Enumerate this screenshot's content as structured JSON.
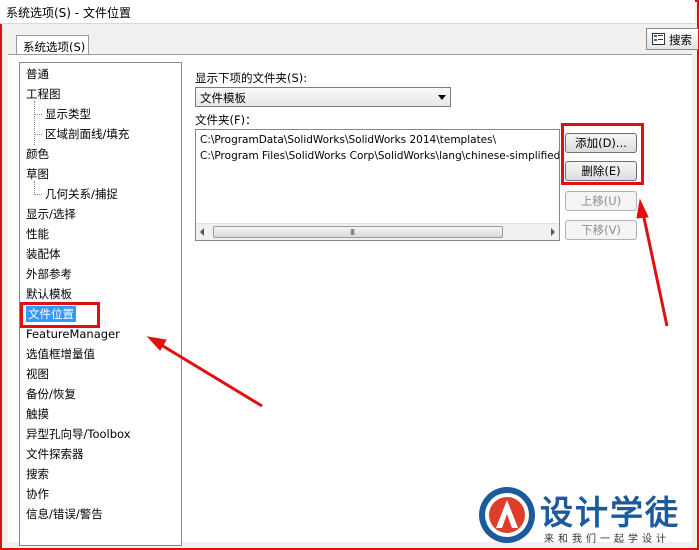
{
  "window": {
    "title": "系统选项(S) - 文件位置"
  },
  "tabs": [
    {
      "label": "系统选项(S)"
    }
  ],
  "search": {
    "label": "搜索"
  },
  "tree": {
    "items": [
      {
        "label": "普通",
        "level": 0
      },
      {
        "label": "工程图",
        "level": 0
      },
      {
        "label": "显示类型",
        "level": 1
      },
      {
        "label": "区域剖面线/填充",
        "level": 1
      },
      {
        "label": "颜色",
        "level": 0
      },
      {
        "label": "草图",
        "level": 0
      },
      {
        "label": "几何关系/捕捉",
        "level": 1
      },
      {
        "label": "显示/选择",
        "level": 0
      },
      {
        "label": "性能",
        "level": 0
      },
      {
        "label": "装配体",
        "level": 0
      },
      {
        "label": "外部参考",
        "level": 0
      },
      {
        "label": "默认模板",
        "level": 0
      },
      {
        "label": "文件位置",
        "level": 0,
        "selected": true
      },
      {
        "label": "FeatureManager",
        "level": 0
      },
      {
        "label": "选值框增量值",
        "level": 0
      },
      {
        "label": "视图",
        "level": 0
      },
      {
        "label": "备份/恢复",
        "level": 0
      },
      {
        "label": "触摸",
        "level": 0
      },
      {
        "label": "异型孔向导/Toolbox",
        "level": 0
      },
      {
        "label": "文件探索器",
        "level": 0
      },
      {
        "label": "搜索",
        "level": 0
      },
      {
        "label": "协作",
        "level": 0
      },
      {
        "label": "信息/错误/警告",
        "level": 0
      }
    ]
  },
  "main": {
    "show_folders_label": "显示下项的文件夹(S):",
    "folder_type_value": "文件模板",
    "folders_label": "文件夹(F)：",
    "folders": [
      "C:\\ProgramData\\SolidWorks\\SolidWorks 2014\\templates\\",
      "C:\\Program Files\\SolidWorks Corp\\SolidWorks\\lang\\chinese-simplified"
    ],
    "scroll_grip": "III",
    "buttons": {
      "add": "添加(D)...",
      "delete": "删除(E)",
      "move_up": "上移(U)",
      "move_down": "下移(V)"
    }
  },
  "watermark": {
    "brand": "设计学徒",
    "slogan": "来和我们一起学设计"
  },
  "colors": {
    "annotation_red": "#e01010",
    "selection_blue": "#3399ff",
    "brand_blue": "#1d5a9a"
  }
}
